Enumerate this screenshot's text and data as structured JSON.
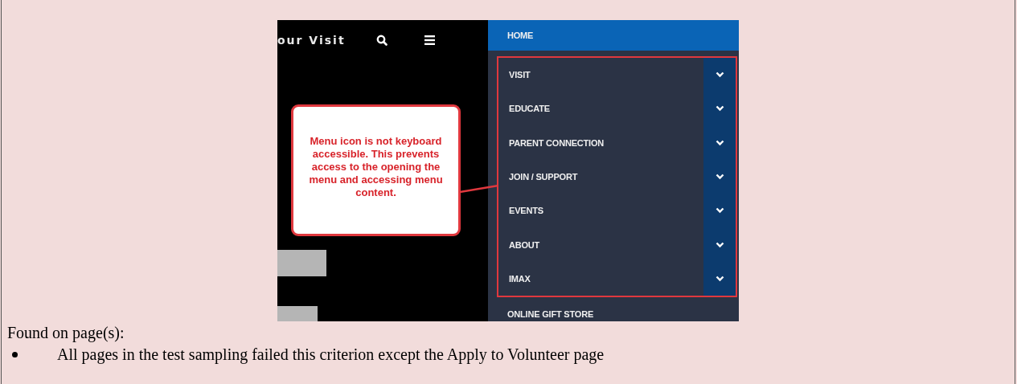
{
  "screenshot": {
    "header_text": "our Visit",
    "callout": "Menu icon is not keyboard accessible. This prevents access to the opening the menu and accessing menu content.",
    "menu_groups": [
      {
        "outlined": false,
        "items": [
          {
            "label": "HOME",
            "selected": true,
            "expandable": false
          }
        ]
      },
      {
        "outlined": true,
        "items": [
          {
            "label": "VISIT",
            "selected": false,
            "expandable": true
          },
          {
            "label": "EDUCATE",
            "selected": false,
            "expandable": true
          },
          {
            "label": "PARENT CONNECTION",
            "selected": false,
            "expandable": true
          },
          {
            "label": "JOIN / SUPPORT",
            "selected": false,
            "expandable": true
          },
          {
            "label": "EVENTS",
            "selected": false,
            "expandable": true
          },
          {
            "label": "ABOUT",
            "selected": false,
            "expandable": true
          },
          {
            "label": "IMAX",
            "selected": false,
            "expandable": true
          }
        ]
      },
      {
        "outlined": false,
        "items": [
          {
            "label": "ONLINE GIFT STORE",
            "selected": false,
            "expandable": false
          }
        ]
      }
    ]
  },
  "found_label": "Found on page(s):",
  "pages": [
    "All pages in the test sampling failed this criterion except the Apply to Volunteer page"
  ]
}
